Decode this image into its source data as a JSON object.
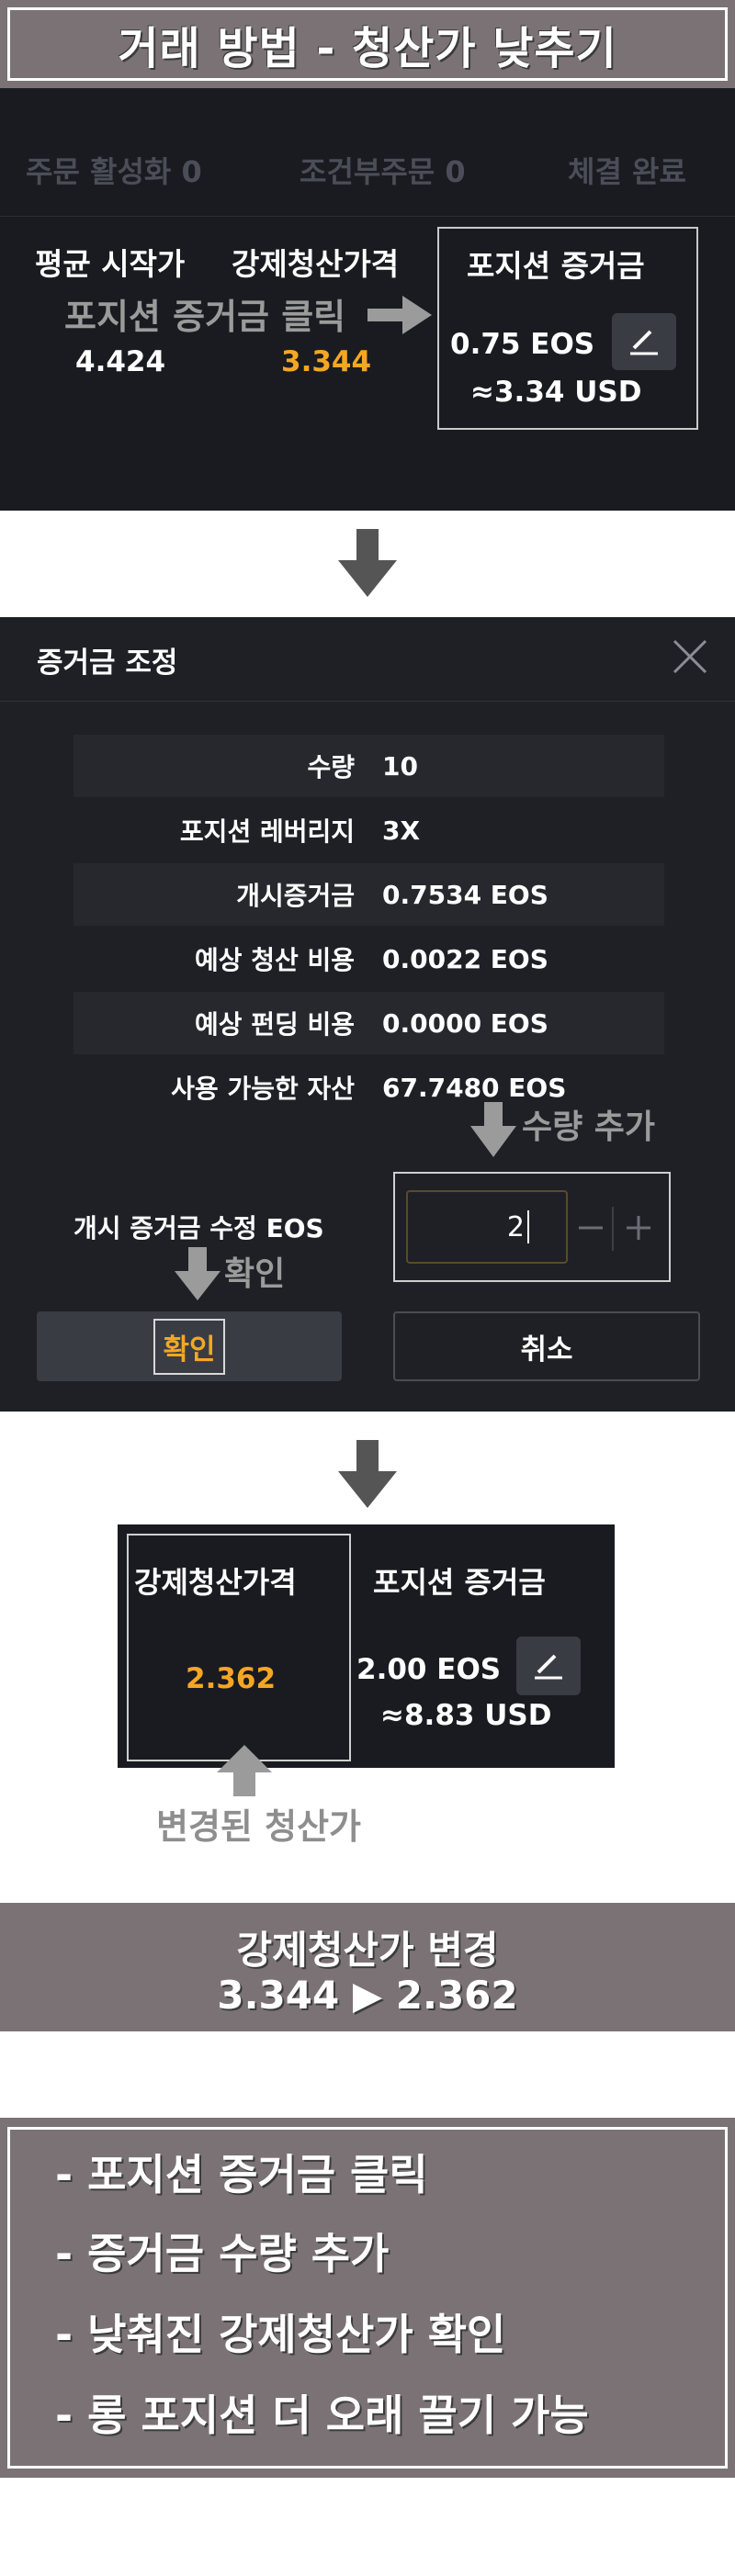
{
  "title": "거래 방법 - 청산가 낮추기",
  "panel1": {
    "tabs": [
      "주문 활성화 0",
      "조건부주문 0",
      "체결 완료"
    ],
    "avg_label": "평균 시작가",
    "liq_label": "강제청산가격",
    "margin_label": "포지션 증거금",
    "avg_value": "4.424",
    "liq_value": "3.344",
    "margin_eos": "0.75 EOS",
    "margin_usd": "≈3.34 USD",
    "annotation": "포지션 증거금 클릭"
  },
  "dialog": {
    "title": "증거금 조정",
    "rows": [
      {
        "label": "수량",
        "value": "10"
      },
      {
        "label": "포지션 레버리지",
        "value": "3X"
      },
      {
        "label": "개시증거금",
        "value": "0.7534 EOS"
      },
      {
        "label": "예상 청산 비용",
        "value": "0.0022 EOS"
      },
      {
        "label": "예상 펀딩 비용",
        "value": "0.0000 EOS"
      },
      {
        "label": "사용 가능한 자산",
        "value": "67.7480 EOS"
      }
    ],
    "adjust_label": "개시 증거금 수정 EOS",
    "input_value": "2",
    "annotation_add": "수량 추가",
    "annotation_confirm": "확인",
    "confirm_label": "확인",
    "cancel_label": "취소"
  },
  "panel3": {
    "liq_label": "강제청산가격",
    "margin_label": "포지션 증거금",
    "liq_value": "2.362",
    "margin_eos": "2.00 EOS",
    "margin_usd": "≈8.83 USD",
    "annotation": "변경된 청산가"
  },
  "summary": {
    "line1": "강제청산가 변경",
    "line2": "3.344 ▶ 2.362"
  },
  "steps": [
    "- 포지션 증거금 클릭",
    "- 증거금 수량 추가",
    "- 낮춰진 강제청산가 확인",
    "- 롱 포지션 더 오래 끌기 가능"
  ],
  "colors": {
    "accent_orange": "#f5a623",
    "panel_bg": "#1a1b20",
    "banner_bg": "#7a7274"
  }
}
